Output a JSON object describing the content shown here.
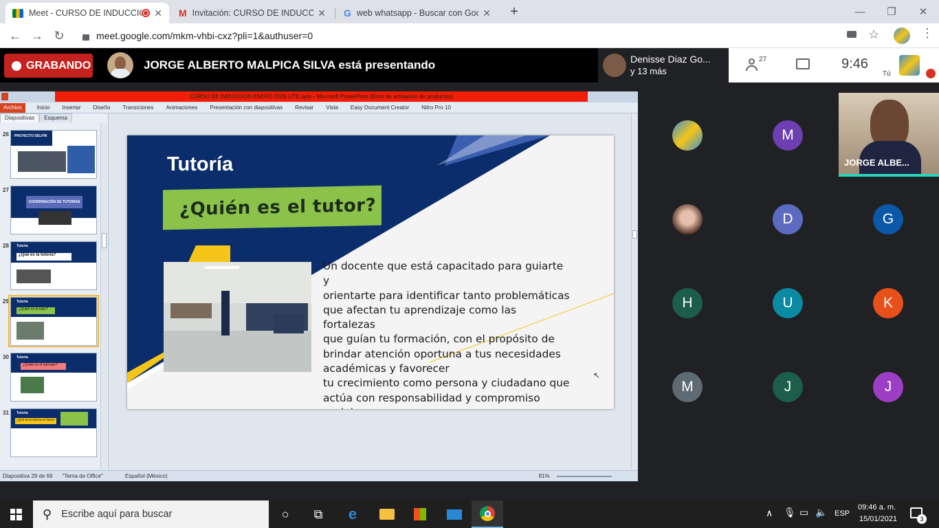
{
  "browser": {
    "tabs": [
      {
        "title": "Meet - CURSO DE INDUCCIO",
        "active": true,
        "recording_icon": "recording-dot-icon"
      },
      {
        "title": "Invitación: CURSO DE INDUCCIO",
        "active": false
      },
      {
        "title": "web whatsapp - Buscar con Goo",
        "active": false
      }
    ],
    "new_tab": "+",
    "url": "meet.google.com/mkm-vhbi-cxz?pli=1&authuser=0",
    "window_controls": {
      "minimize": "—",
      "restore": "❐",
      "close": "✕"
    }
  },
  "meet": {
    "recording_label": "GRABANDO",
    "presenter_text": "JORGE ALBERTO MALPICA SILVA está presentando",
    "participant_preview": {
      "name": "Denisse Diaz Go...",
      "more": "y 13 más"
    },
    "participant_count": "27",
    "time": "9:46",
    "self_label": "Tú",
    "featured_tile_name": "JORGE ALBE...",
    "tiles": [
      {
        "initial": "",
        "color": "#3a8fd6",
        "kind": "logo"
      },
      {
        "initial": "M",
        "color": "#6d3fb0"
      },
      {
        "initial": "",
        "color": "#c78f7d",
        "kind": "photo"
      },
      {
        "initial": "D",
        "color": "#5c6bc0"
      },
      {
        "initial": "G",
        "color": "#0b57a8"
      },
      {
        "initial": "H",
        "color": "#1c5e49"
      },
      {
        "initial": "U",
        "color": "#0b8aa3"
      },
      {
        "initial": "K",
        "color": "#e8501b"
      },
      {
        "initial": "M",
        "color": "#5e6b75"
      },
      {
        "initial": "J",
        "color": "#1c5e49"
      },
      {
        "initial": "J",
        "color": "#9c3fc4"
      }
    ]
  },
  "ppt": {
    "title": "CURSO DE INDUCCION ENERO 2020 LITE.pptx - Microsoft PowerPoint (Error de activación de productos)",
    "ribbon": [
      "Archivo",
      "Inicio",
      "Insertar",
      "Diseño",
      "Transiciones",
      "Animaciones",
      "Presentación con diapositivas",
      "Revisar",
      "Vista",
      "Easy Document Creator",
      "Nitro Pro 10"
    ],
    "panel_tabs": [
      "Diapositivas",
      "Esquema"
    ],
    "thumbnails": [
      {
        "num": "26",
        "title": "PROYECTO DELFIN"
      },
      {
        "num": "27",
        "title": "COORDINACIÓN DE TUTORIAS"
      },
      {
        "num": "28",
        "title": "Tutoría",
        "subtitle": "¿Qué es la tutoría?"
      },
      {
        "num": "29",
        "title": "Tutoría",
        "subtitle": "¿Quién es el tutor?"
      },
      {
        "num": "30",
        "title": "Tutoría",
        "subtitle": "¿Quién es el tutorado?"
      },
      {
        "num": "31",
        "title": "Tutoría",
        "subtitle": "¿Qué es la tutoría en línea?"
      }
    ],
    "status": {
      "slide_of": "Diapositiva 29 de 69",
      "theme": "\"Tema de Office\"",
      "language": "Español (México)",
      "zoom": "81%"
    },
    "slide": {
      "heading": "Tutoría",
      "banner": "¿Quién es el tutor?",
      "body_lines": [
        "Un docente que está capacitado para guiarte y",
        "orientarte para identificar tanto problemáticas",
        "que afectan tu aprendizaje como las fortalezas",
        "que guían tu formación, con el propósito de",
        "brindar atención oportuna a tus necesidades",
        "académicas y favorecer",
        "tu crecimiento como persona y ciudadano que",
        "actúa con responsabilidad y compromiso social."
      ]
    }
  },
  "taskbar": {
    "search_placeholder": "Escribe aquí para buscar",
    "lang": "ESP",
    "time": "09:46 a. m.",
    "date": "15/01/2021",
    "notifications": "3"
  }
}
